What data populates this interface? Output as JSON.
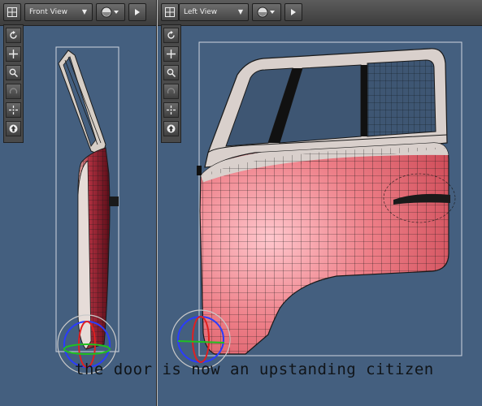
{
  "viewports": {
    "front": {
      "label": "Front View",
      "select_arrow": "▼",
      "icons": [
        "layout-grid-icon",
        "shading-sphere-icon",
        "play-icon"
      ]
    },
    "left": {
      "label": "Left View",
      "select_arrow": "▼",
      "icons": [
        "layout-grid-icon",
        "shading-sphere-icon",
        "play-icon"
      ]
    }
  },
  "toolbar": {
    "tools": [
      "rotate-view-icon",
      "pan-view-icon",
      "zoom-view-icon",
      "undo-view-icon",
      "fit-view-icon",
      "home-view-icon"
    ]
  },
  "caption": "the door is now an upstanding citizen",
  "colors": {
    "viewport_bg": "#445f7f",
    "door_body": "#e26f7a",
    "door_frame": "#d9d0cc",
    "window_glass": "#3e5673",
    "wire": "#1a1a1a"
  }
}
